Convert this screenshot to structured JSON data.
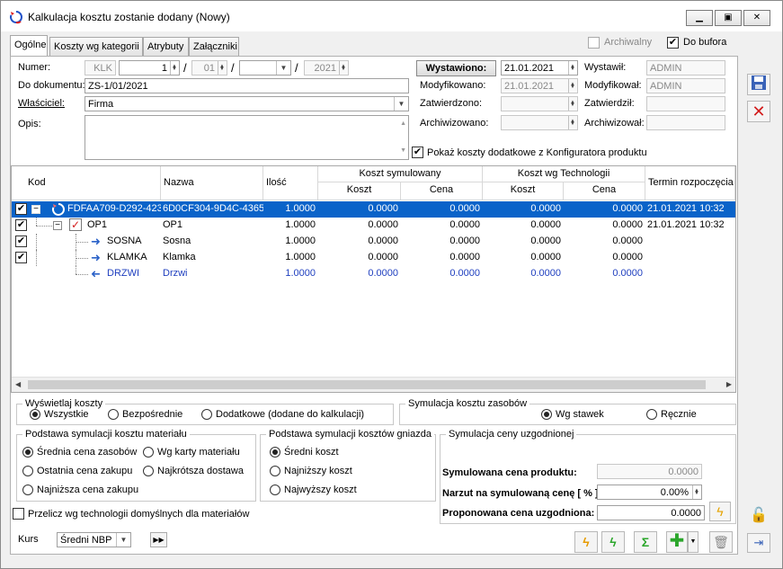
{
  "window": {
    "title": "Kalkulacja kosztu zostanie dodany  (Nowy)"
  },
  "tabs": [
    "Ogólne",
    "Koszty wg kategorii",
    "Atrybuty",
    "Załączniki"
  ],
  "flags": {
    "archiwalny": "Archiwalny",
    "do_bufora": "Do bufora"
  },
  "form": {
    "numer_label": "Numer:",
    "numer_prefix": "KLK",
    "numer_no": "1",
    "numer_month": "01",
    "numer_year": "2021",
    "do_dokumentu_label": "Do dokumentu:",
    "do_dokumentu": "ZS-1/01/2021",
    "wlasciciel_label": "Właściciel:",
    "wlasciciel": "Firma",
    "opis_label": "Opis:",
    "wystawiono_label": "Wystawiono:",
    "wystawiono": "21.01.2021",
    "modyfikowano_label": "Modyfikowano:",
    "modyfikowano": "21.01.2021",
    "zatwierdzono_label": "Zatwierdzono:",
    "archiwizowano_label": "Archiwizowano:",
    "wystawil_label": "Wystawił:",
    "wystawil": "ADMIN",
    "modyfikowal_label": "Modyfikował:",
    "modyfikowal": "ADMIN",
    "zatwierdzil_label": "Zatwierdził:",
    "archiwizowal_label": "Archiwizował:",
    "pokaz_label": "Pokaż koszty dodatkowe z Konfiguratora produktu",
    "sep": "/"
  },
  "grid": {
    "headers": {
      "kod": "Kod",
      "nazwa": "Nazwa",
      "ilosc": "Ilość",
      "sym": "Koszt symulowany",
      "tech": "Koszt wg Technologii",
      "koszt": "Koszt",
      "cena": "Cena",
      "termin": "Termin rozpoczęcia"
    },
    "rows": [
      {
        "kod": "FDFAA709-D292-423",
        "nazwa": "6D0CF304-9D4C-4365-",
        "ilosc": "1.0000",
        "k1": "0.0000",
        "c1": "0.0000",
        "k2": "0.0000",
        "c2": "0.0000",
        "termin": "21.01.2021 10:32"
      },
      {
        "kod": "OP1",
        "nazwa": "OP1",
        "ilosc": "1.0000",
        "k1": "0.0000",
        "c1": "0.0000",
        "k2": "0.0000",
        "c2": "0.0000",
        "termin": "21.01.2021 10:32"
      },
      {
        "kod": "SOSNA",
        "nazwa": "Sosna",
        "ilosc": "1.0000",
        "k1": "0.0000",
        "c1": "0.0000",
        "k2": "0.0000",
        "c2": "0.0000",
        "termin": ""
      },
      {
        "kod": "KLAMKA",
        "nazwa": "Klamka",
        "ilosc": "1.0000",
        "k1": "0.0000",
        "c1": "0.0000",
        "k2": "0.0000",
        "c2": "0.0000",
        "termin": ""
      },
      {
        "kod": "DRZWI",
        "nazwa": "Drzwi",
        "ilosc": "1.0000",
        "k1": "0.0000",
        "c1": "0.0000",
        "k2": "0.0000",
        "c2": "0.0000",
        "termin": ""
      }
    ]
  },
  "wyswietlaj": {
    "title": "Wyświetlaj koszty",
    "opt1": "Wszystkie",
    "opt2": "Bezpośrednie",
    "opt3": "Dodatkowe (dodane do kalkulacji)"
  },
  "symzasobow": {
    "title": "Symulacja kosztu zasobów",
    "opt1": "Wg stawek",
    "opt2": "Ręcznie"
  },
  "podmat": {
    "title": "Podstawa symulacji kosztu materiału",
    "opt1": "Średnia cena zasobów",
    "opt2": "Wg karty materiału",
    "opt3": "Ostatnia cena zakupu",
    "opt4": "Najkrótsza dostawa",
    "opt5": "Najniższa cena zakupu"
  },
  "podgn": {
    "title": "Podstawa symulacji kosztów gniazda",
    "opt1": "Średni koszt",
    "opt2": "Najniższy koszt",
    "opt3": "Najwyższy koszt"
  },
  "symceny": {
    "title": "Symulacja ceny uzgodnionej",
    "l1": "Symulowana cena produktu:",
    "v1": "0.0000",
    "l2": "Narzut na symulowaną cenę [ % ]:",
    "v2": "0.00%",
    "l3": "Proponowana cena uzgodniona:",
    "v3": "0.0000"
  },
  "przelicz": "Przelicz wg technologii domyślnych dla materiałów",
  "kurs": {
    "label": "Kurs",
    "value": "Średni NBP"
  }
}
